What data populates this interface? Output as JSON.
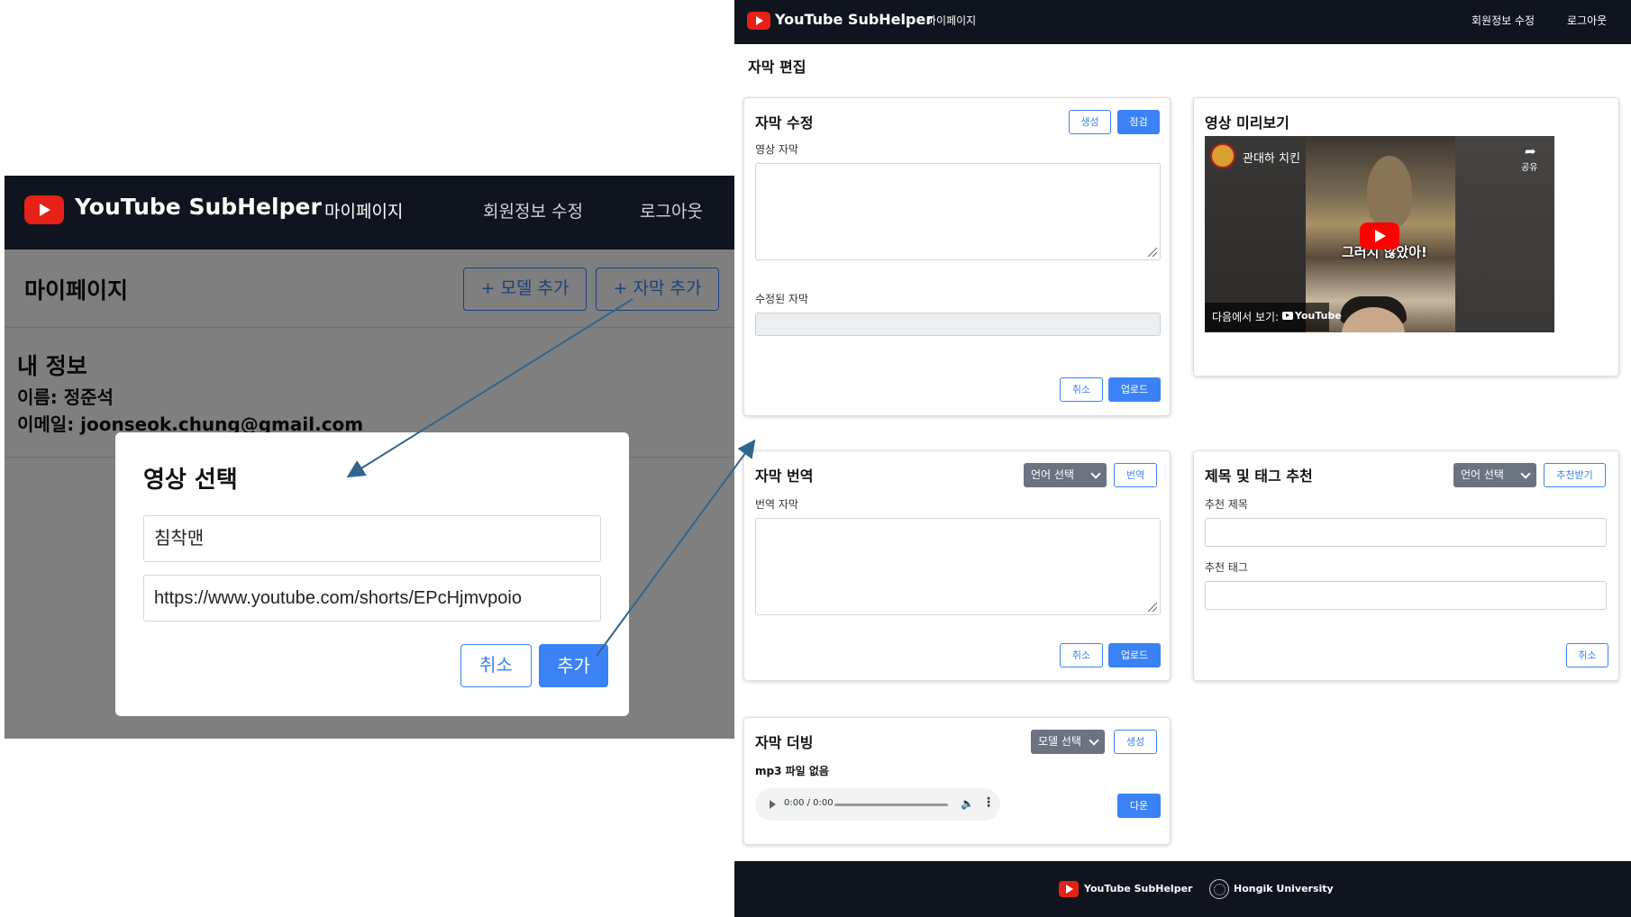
{
  "left": {
    "nav": {
      "brand": "YouTube SubHelper",
      "mypage": "마이페이지",
      "edit_profile": "회원정보 수정",
      "logout": "로그아웃"
    },
    "page_title": "마이페이지",
    "add_model_button": "+ 모델 추가",
    "add_subtitle_button": "+ 자막 추가",
    "info": {
      "title": "내 정보",
      "name_line": "이름: 정준석",
      "email_line": "이메일: joonseok.chung@gmail.com"
    },
    "modal": {
      "title": "영상 선택",
      "name_value": "침착맨",
      "url_value": "https://www.youtube.com/shorts/EPcHjmvpoio",
      "cancel": "취소",
      "add": "추가"
    }
  },
  "right": {
    "nav": {
      "brand": "YouTube SubHelper",
      "mypage": "마이페이지",
      "edit_profile": "회원정보 수정",
      "logout": "로그아웃"
    },
    "page_title": "자막 편집",
    "edit_card": {
      "title": "자막 수정",
      "generate": "생성",
      "check": "점검",
      "original_label": "영상 자막",
      "edited_label": "수정된 자막",
      "cancel": "취소",
      "upload": "업로드"
    },
    "preview_card": {
      "title": "영상 미리보기",
      "channel": "관대하 치킨",
      "caption": "그러지 않았아!",
      "share": "공유",
      "watch_on": "다음에서 보기:",
      "youtube": "YouTube"
    },
    "translate_card": {
      "title": "자막 번역",
      "language_select": "언어 선택",
      "translate": "번역",
      "translated_label": "번역 자막",
      "cancel": "취소",
      "upload": "업로드"
    },
    "recommend_card": {
      "title": "제목 및 태그 추천",
      "language_select": "언어 선택",
      "recommend": "추천받기",
      "title_label": "추천 제목",
      "tags_label": "추천 태그",
      "cancel": "취소"
    },
    "dubbing_card": {
      "title": "자막 더빙",
      "model_select": "모델 선택",
      "generate": "생성",
      "no_file": "mp3 파일 없음",
      "audio_time": "0:00 / 0:00",
      "download": "다운"
    },
    "footer": {
      "brand": "YouTube SubHelper",
      "university": "Hongik University"
    }
  },
  "colors": {
    "nav_bg": "#10141f",
    "accent": "#3b82f6",
    "select_bg": "#6b7280",
    "youtube_red": "#e62117",
    "arrow": "#2f6690"
  }
}
